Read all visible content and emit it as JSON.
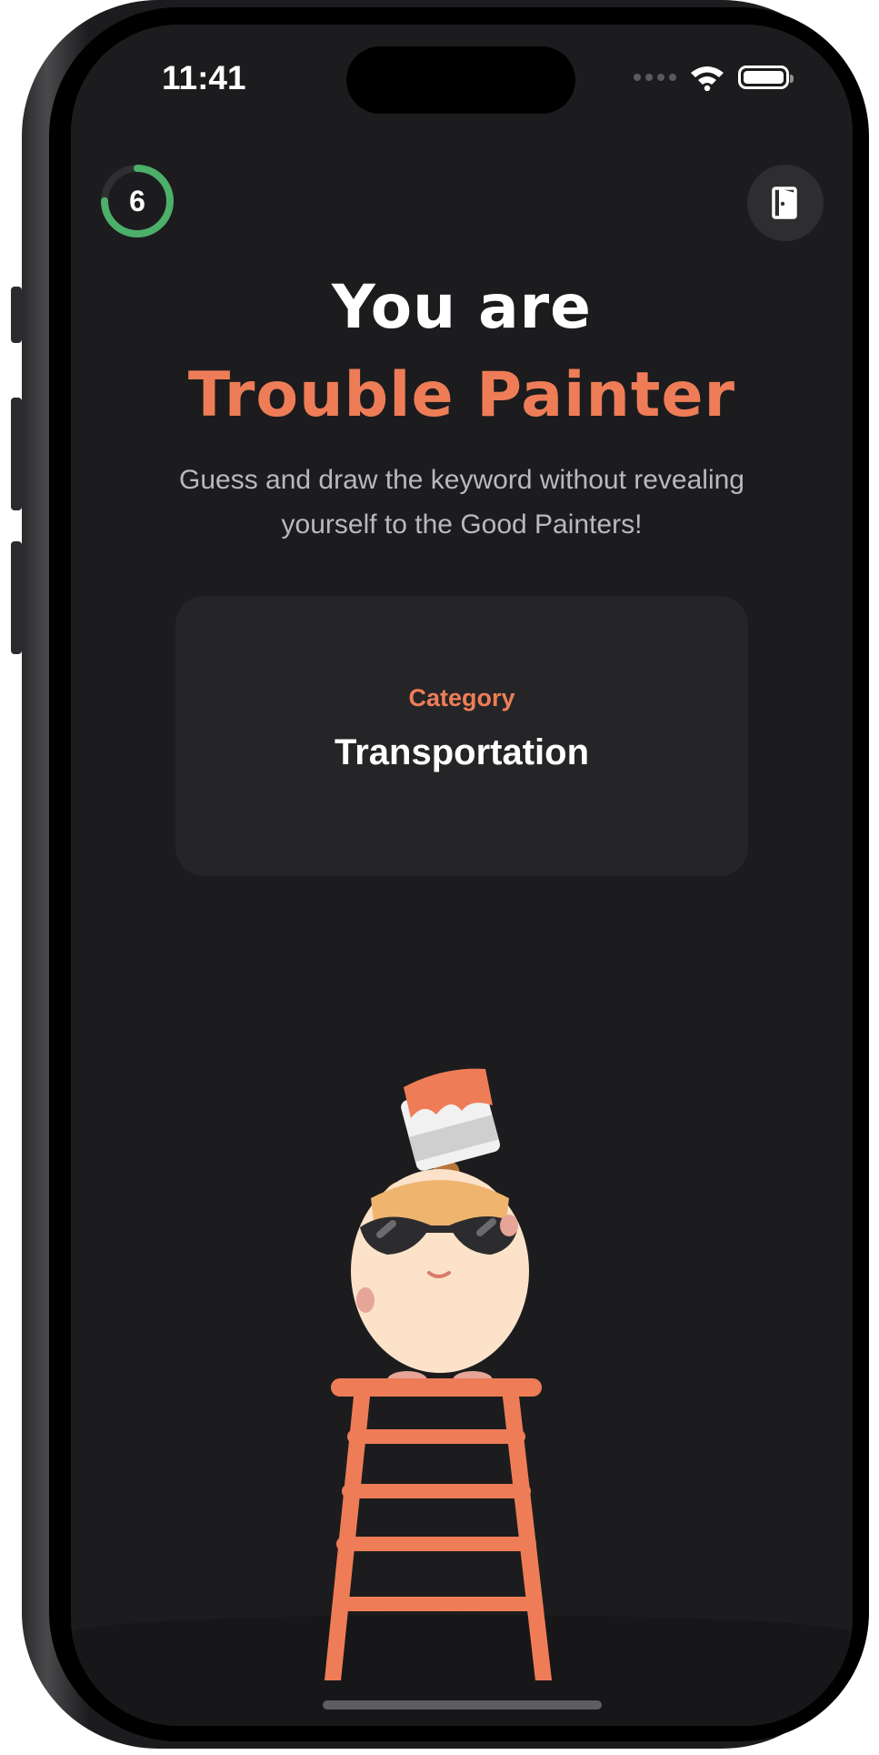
{
  "status_bar": {
    "time": "11:41"
  },
  "timer": {
    "value": "6",
    "progress_fraction": 0.75,
    "color": "#4caf6a"
  },
  "header": {
    "line1": "You are",
    "line2": "Trouble Painter"
  },
  "description": "Guess and draw the keyword without revealing yourself to the Good Painters!",
  "card": {
    "label": "Category",
    "value": "Transportation"
  },
  "icons": {
    "exit": "exit-door-icon",
    "wifi": "wifi-icon",
    "battery": "battery-icon"
  },
  "colors": {
    "accent": "#ee7d57",
    "background": "#1c1c1e",
    "card": "#252527"
  }
}
